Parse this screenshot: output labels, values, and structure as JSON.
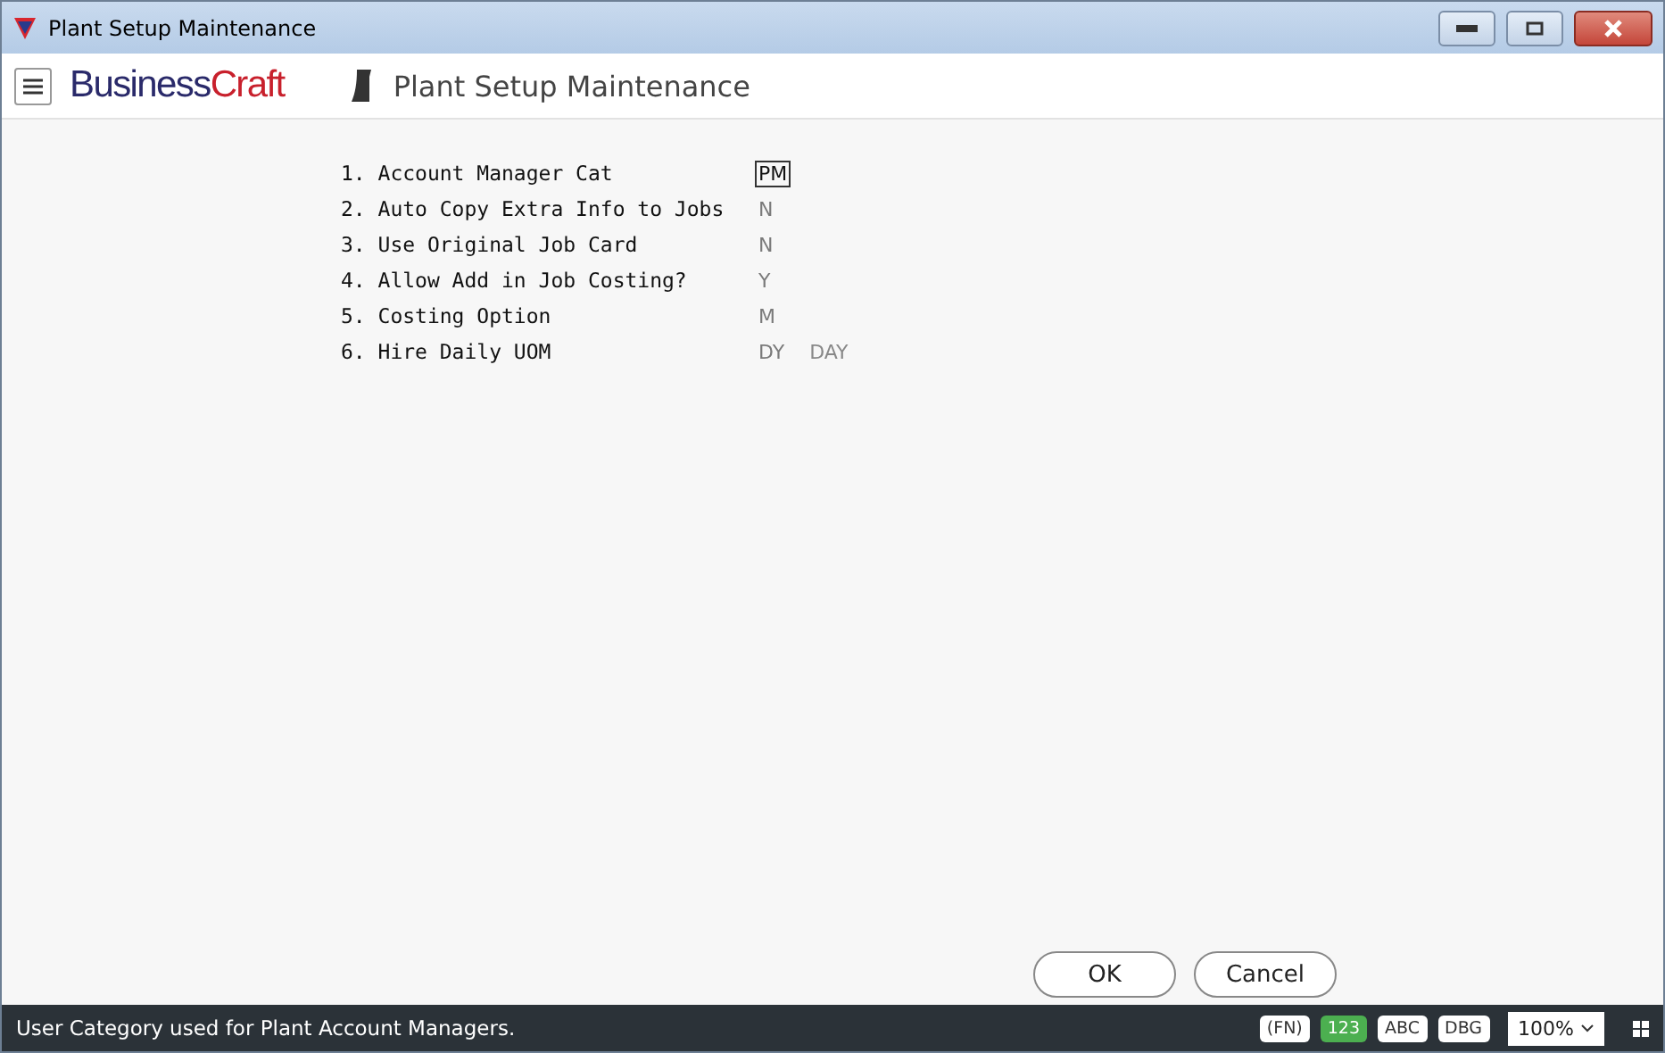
{
  "window": {
    "title": "Plant Setup Maintenance"
  },
  "header": {
    "logo_part_1": "Business",
    "logo_part_2": "Craft",
    "title": "Plant Setup Maintenance"
  },
  "fields": [
    {
      "number": "1.",
      "label": "Account Manager Cat",
      "value": "PM",
      "focused": true
    },
    {
      "number": "2.",
      "label": "Auto Copy Extra Info to Jobs",
      "value": "N",
      "focused": false
    },
    {
      "number": "3.",
      "label": "Use Original Job Card",
      "value": "N",
      "focused": false
    },
    {
      "number": "4.",
      "label": "Allow Add in Job Costing?",
      "value": "Y",
      "focused": false
    },
    {
      "number": "5.",
      "label": "Costing Option",
      "value": "M",
      "focused": false
    },
    {
      "number": "6.",
      "label": "Hire Daily UOM",
      "value": "DY",
      "description": "DAY",
      "focused": false
    }
  ],
  "buttons": [
    "OK",
    "Cancel"
  ],
  "status_bar": {
    "message": "User Category used for Plant Account Managers.",
    "modes": [
      {
        "label": "(FN)",
        "selected": false
      },
      {
        "label": "123",
        "selected": true
      },
      {
        "label": "ABC",
        "selected": false
      },
      {
        "label": "DBG",
        "selected": false
      }
    ],
    "zoom": "100%"
  }
}
